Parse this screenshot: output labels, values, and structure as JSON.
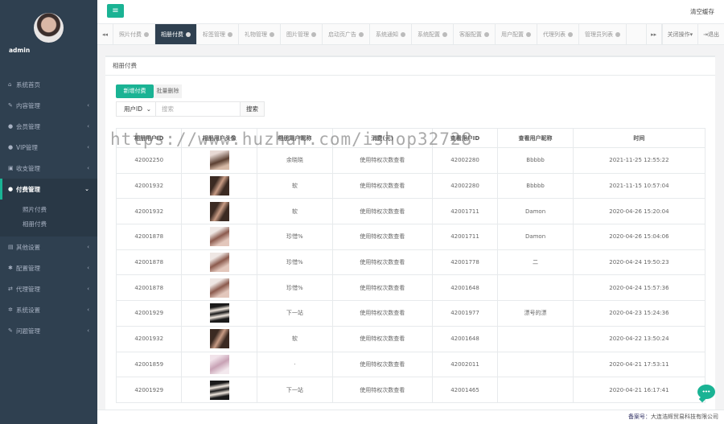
{
  "profile": {
    "name": "admin"
  },
  "sidebar": {
    "items": [
      {
        "icon": "home-icon",
        "glyph": "⌂",
        "label": "系统首页",
        "arrow": ""
      },
      {
        "icon": "edit-icon",
        "glyph": "✎",
        "label": "内容管理",
        "arrow": "‹"
      },
      {
        "icon": "users-icon",
        "glyph": "●",
        "label": "会员管理",
        "arrow": "‹"
      },
      {
        "icon": "vip-icon",
        "glyph": "●",
        "label": "VIP管理",
        "arrow": "‹"
      },
      {
        "icon": "money-icon",
        "glyph": "▣",
        "label": "收支管理",
        "arrow": "‹"
      },
      {
        "icon": "user-icon",
        "glyph": "●",
        "label": "付费管理",
        "arrow": "⌄"
      },
      {
        "icon": "chart-icon",
        "glyph": "▤",
        "label": "其他设置",
        "arrow": "‹"
      },
      {
        "icon": "gear-icon",
        "glyph": "✱",
        "label": "配置管理",
        "arrow": "‹"
      },
      {
        "icon": "exchange-icon",
        "glyph": "⇄",
        "label": "代理管理",
        "arrow": "‹"
      },
      {
        "icon": "cogs-icon",
        "glyph": "✲",
        "label": "系统设置",
        "arrow": "‹"
      },
      {
        "icon": "edit-icon",
        "glyph": "✎",
        "label": "问题管理",
        "arrow": "‹"
      }
    ],
    "submenu": [
      "照片付费",
      "相册付费"
    ]
  },
  "topbar": {
    "menu_glyph": "≡",
    "clear_cache": "清空缓存"
  },
  "tabs": {
    "prev": "◂◂",
    "items": [
      {
        "label": "照片付费",
        "active": false
      },
      {
        "label": "相册付费",
        "active": true
      },
      {
        "label": "标签管理",
        "active": false
      },
      {
        "label": "礼物管理",
        "active": false
      },
      {
        "label": "图片管理",
        "active": false
      },
      {
        "label": "启动页广告",
        "active": false
      },
      {
        "label": "系统通知",
        "active": false
      },
      {
        "label": "系统配置",
        "active": false
      },
      {
        "label": "客服配置",
        "active": false
      },
      {
        "label": "用户配置",
        "active": false
      },
      {
        "label": "代理列表",
        "active": false
      },
      {
        "label": "管理员列表",
        "active": false
      }
    ],
    "next": "▸▸",
    "close_ops": "关闭操作▾",
    "logout": "⇥退出"
  },
  "content": {
    "title": "相册付费",
    "watermark": "https://www.huzhan.com/ishop32728",
    "btn_green": "新增付费",
    "btn_gray": "批量删除",
    "search": {
      "select_value": "用户ID",
      "placeholder": "搜索",
      "button": "搜索"
    }
  },
  "table": {
    "headers": [
      "相册用户ID",
      "相册用户头像",
      "相册用户昵称",
      "消费(元)",
      "查看用户ID",
      "查看用户昵称",
      "时间"
    ],
    "rows": [
      {
        "uid": "42002250",
        "thumb": "thumb-a",
        "nick": "余晓晓",
        "cost": "使用特权次数查看",
        "vid": "42002280",
        "vnick": "Bbbbb",
        "time": "2021-11-25 12:55:22"
      },
      {
        "uid": "42001932",
        "thumb": "thumb-b",
        "nick": "软",
        "cost": "使用特权次数查看",
        "vid": "42002280",
        "vnick": "Bbbbb",
        "time": "2021-11-15 10:57:04"
      },
      {
        "uid": "42001932",
        "thumb": "thumb-b",
        "nick": "软",
        "cost": "使用特权次数查看",
        "vid": "42001711",
        "vnick": "Damon",
        "time": "2020-04-26 15:20:04"
      },
      {
        "uid": "42001878",
        "thumb": "thumb-c",
        "nick": "珍惜%",
        "cost": "使用特权次数查看",
        "vid": "42001711",
        "vnick": "Damon",
        "time": "2020-04-26 15:04:06"
      },
      {
        "uid": "42001878",
        "thumb": "thumb-c",
        "nick": "珍惜%",
        "cost": "使用特权次数查看",
        "vid": "42001778",
        "vnick": "二",
        "time": "2020-04-24 19:50:23"
      },
      {
        "uid": "42001878",
        "thumb": "thumb-c",
        "nick": "珍惜%",
        "cost": "使用特权次数查看",
        "vid": "42001648",
        "vnick": "",
        "time": "2020-04-24 15:57:36"
      },
      {
        "uid": "42001929",
        "thumb": "thumb-d",
        "nick": "下一站",
        "cost": "使用特权次数查看",
        "vid": "42001977",
        "vnick": "漂号的漂",
        "time": "2020-04-23 15:24:36"
      },
      {
        "uid": "42001932",
        "thumb": "thumb-b",
        "nick": "软",
        "cost": "使用特权次数查看",
        "vid": "42001648",
        "vnick": "",
        "time": "2020-04-22 13:50:24"
      },
      {
        "uid": "42001859",
        "thumb": "thumb-e",
        "nick": "·",
        "cost": "使用特权次数查看",
        "vid": "42002011",
        "vnick": "",
        "time": "2020-04-21 17:53:11"
      },
      {
        "uid": "42001929",
        "thumb": "thumb-d",
        "nick": "下一站",
        "cost": "使用特权次数查看",
        "vid": "42001465",
        "vnick": "",
        "time": "2020-04-21 16:17:41"
      }
    ]
  },
  "footer": {
    "label": "备案号：",
    "text": "大连浩辉贸易科技有限公司"
  },
  "colors": {
    "sidebar": "#2f4050",
    "accent": "#1ab394"
  }
}
